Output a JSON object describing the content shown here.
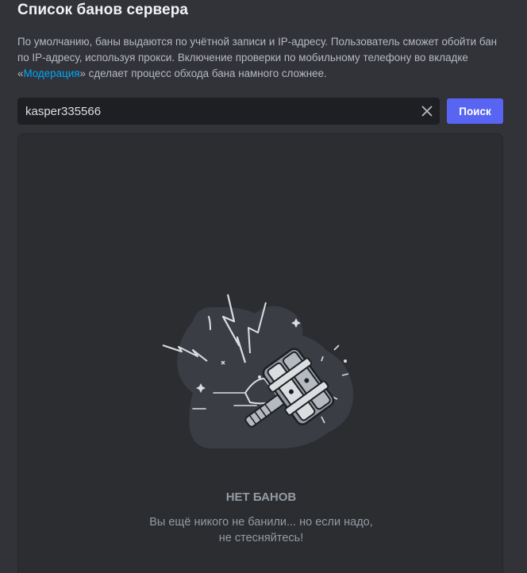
{
  "header": {
    "title": "Список банов сервера"
  },
  "description": {
    "text_before_link": "По умолчанию, баны выдаются по учётной записи и IP-адресу. Пользователь сможет обойти бан по IP-адресу, используя прокси. Включение проверки по мобильному телефону во вкладке «",
    "link_label": "Модерация",
    "text_after_link": "» сделает процесс обхода бана намного сложнее."
  },
  "search": {
    "value": "kasper335566",
    "button_label": "Поиск"
  },
  "empty_state": {
    "title": "НЕТ БАНОВ",
    "line1": "Вы ещё никого не банили... но если надо,",
    "line2": "не стесняйтесь!"
  },
  "colors": {
    "background": "#313338",
    "panel": "#2b2d31",
    "input": "#1e1f22",
    "accent": "#5865f2",
    "link": "#00a8fc"
  },
  "icons": {
    "clear": "close-icon",
    "illustration": "ban-hammer-illustration"
  }
}
